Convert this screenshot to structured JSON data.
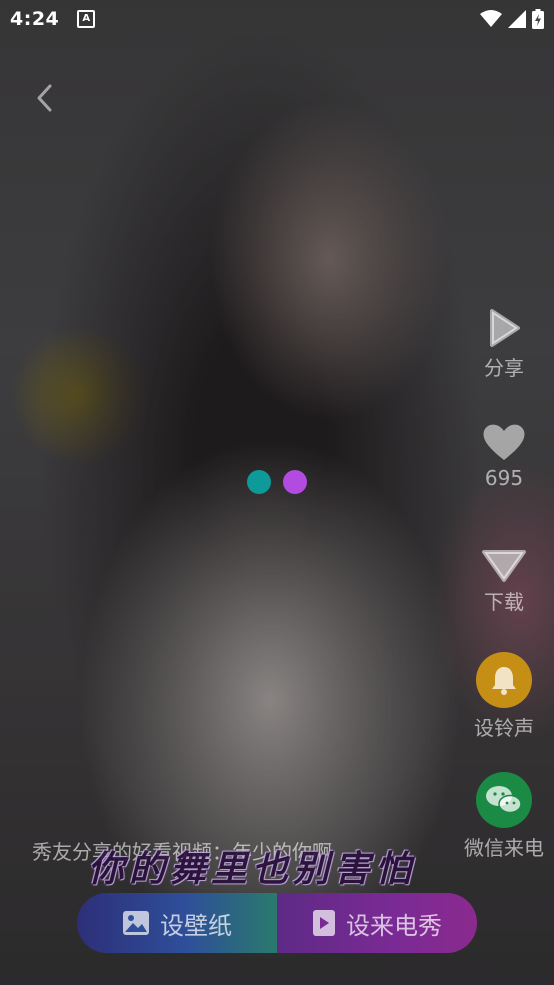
{
  "status_bar": {
    "time": "4:24",
    "notification_icon": "a-letter-icon",
    "wifi_icon": "wifi-icon",
    "signal_icon": "signal-icon",
    "battery_icon": "battery-charging-icon"
  },
  "nav": {
    "back_icon": "chevron-left-icon"
  },
  "loader": {
    "colors": [
      "#0e9a98",
      "#b24be0"
    ]
  },
  "side_actions": {
    "share": {
      "icon": "play-share-icon",
      "label": "分享"
    },
    "like": {
      "icon": "heart-icon",
      "count": "695"
    },
    "download": {
      "icon": "download-arrow-icon",
      "label": "下载"
    },
    "ringtone": {
      "icon": "bell-icon",
      "label": "设铃声",
      "color": "#d9a21a"
    },
    "wechat": {
      "icon": "wechat-icon",
      "label": "微信来电",
      "color": "#1f9c4d"
    }
  },
  "video": {
    "caption": "秀友分享的好看视频：年少的你啊",
    "lyric": "你的舞里也别害怕"
  },
  "bottom_actions": {
    "wallpaper": {
      "icon": "image-icon",
      "label": "设壁纸"
    },
    "call_show": {
      "icon": "video-play-icon",
      "label": "设来电秀"
    }
  }
}
